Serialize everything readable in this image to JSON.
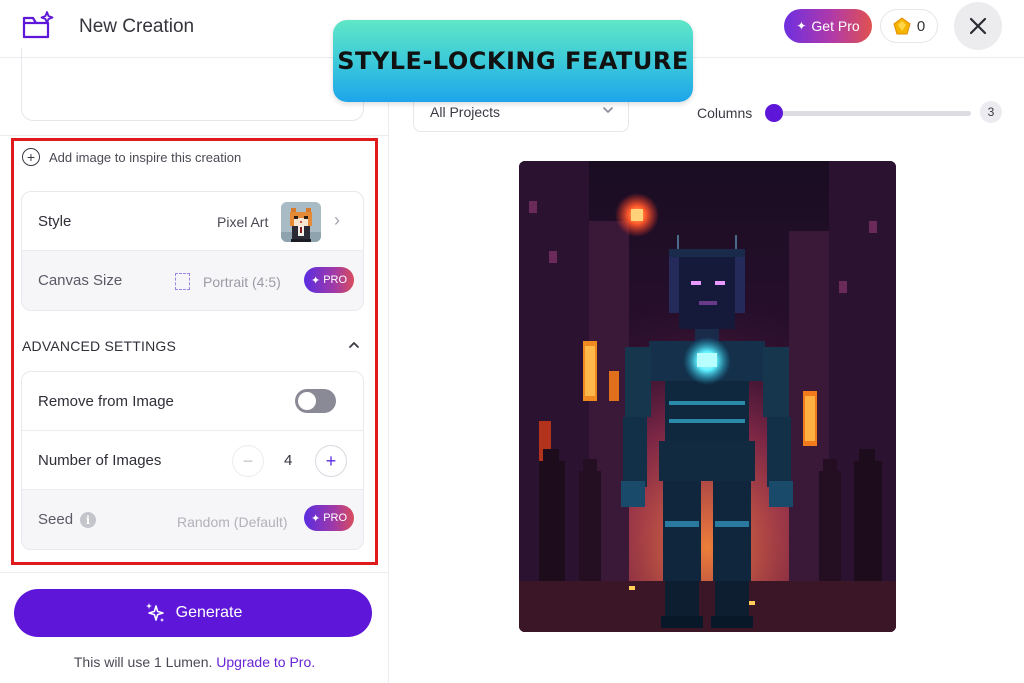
{
  "header": {
    "title": "New Creation",
    "get_pro_label": "Get Pro",
    "lumen_count": "0"
  },
  "banner": {
    "text": "STYLE-LOCKING FEATURE"
  },
  "left_panel": {
    "add_image_label": "Add image to inspire this creation",
    "style": {
      "label": "Style",
      "value": "Pixel Art"
    },
    "canvas": {
      "label": "Canvas Size",
      "value": "Portrait (4:5)",
      "badge": "PRO"
    },
    "advanced": {
      "title": "ADVANCED SETTINGS",
      "remove_label": "Remove from Image",
      "remove_enabled": false,
      "images_label": "Number of Images",
      "images_count": "4",
      "seed_label": "Seed",
      "seed_value": "Random (Default)",
      "seed_badge": "PRO"
    },
    "generate_label": "Generate",
    "lumen_note": "This will use 1 Lumen.",
    "upgrade_link": "Upgrade to Pro."
  },
  "right_panel": {
    "project_select": "All Projects",
    "columns_label": "Columns",
    "columns_value": "3",
    "columns_fraction": 0
  },
  "colors": {
    "accent": "#5e17d8",
    "highlight": "#e01a1a",
    "banner": "#3ccad9"
  }
}
